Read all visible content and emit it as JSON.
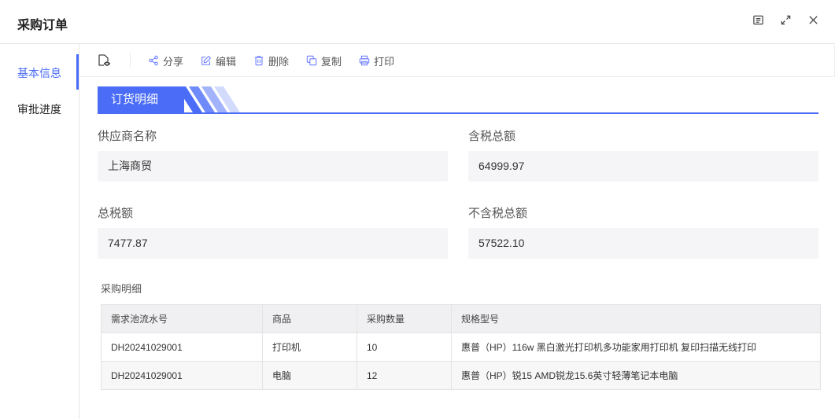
{
  "window": {
    "title": "采购订单"
  },
  "sidebar": {
    "items": [
      {
        "label": "基本信息",
        "active": true
      },
      {
        "label": "审批进度",
        "active": false
      }
    ]
  },
  "toolbar": {
    "share_label": "分享",
    "edit_label": "编辑",
    "delete_label": "删除",
    "copy_label": "复制",
    "print_label": "打印"
  },
  "section": {
    "title": "订货明细"
  },
  "fields": {
    "supplier_label": "供应商名称",
    "supplier_value": "上海商贸",
    "total_tax_incl_label": "含税总额",
    "total_tax_incl_value": "64999.97",
    "total_tax_label": "总税额",
    "total_tax_value": "7477.87",
    "total_excl_label": "不含税总额",
    "total_excl_value": "57522.10"
  },
  "detail": {
    "title": "采购明细",
    "columns": [
      "需求池流水号",
      "商品",
      "采购数量",
      "规格型号"
    ],
    "rows": [
      [
        "DH20241029001",
        "打印机",
        "10",
        "惠普（HP）116w 黑白激光打印机多功能家用打印机 复印扫描无线打印"
      ],
      [
        "DH20241029001",
        "电脑",
        "12",
        "惠普（HP）锐15 AMD锐龙15.6英寸轻薄笔记本电脑"
      ]
    ]
  },
  "colors": {
    "accent": "#4a6cf7"
  }
}
